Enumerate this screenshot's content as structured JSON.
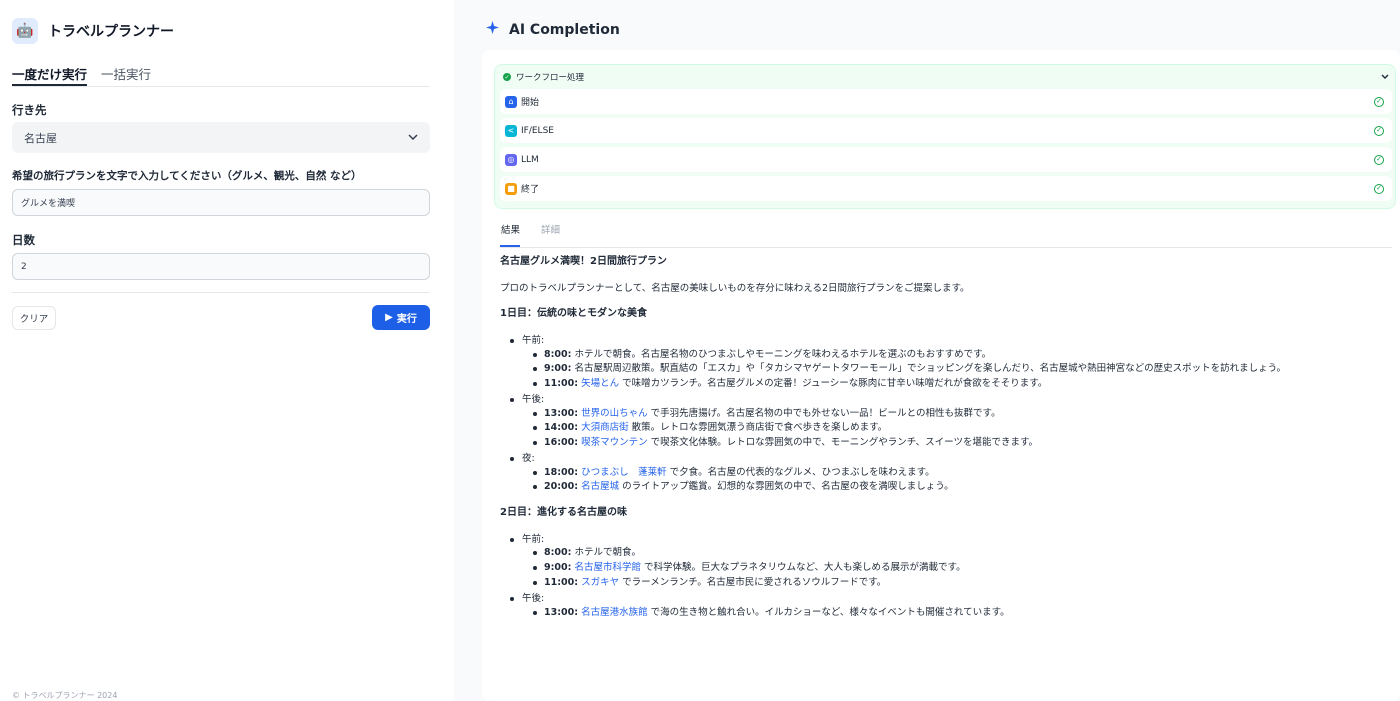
{
  "app": {
    "title": "トラベルプランナー"
  },
  "left": {
    "tabs": [
      {
        "label": "一度だけ実行"
      },
      {
        "label": "一括実行"
      }
    ],
    "destination": {
      "label": "行き先",
      "value": "名古屋"
    },
    "plan": {
      "label": "希望の旅行プランを文字で入力してください（グルメ、観光、自然 など）",
      "value": "グルメを満喫"
    },
    "days": {
      "label": "日数",
      "value": "2"
    },
    "clear_label": "クリア",
    "run_label": "実行",
    "footer": "© トラベルプランナー 2024"
  },
  "right": {
    "title": "AI Completion",
    "workflow": {
      "header": "ワークフロー処理",
      "nodes": [
        {
          "label": "開始",
          "color": "#2563eb"
        },
        {
          "label": "IF/ELSE",
          "color": "#06b6d4"
        },
        {
          "label": "LLM",
          "color": "#6366f1"
        },
        {
          "label": "終了",
          "color": "#f59e0b"
        }
      ]
    },
    "tabs": [
      {
        "label": "結果"
      },
      {
        "label": "詳細"
      }
    ],
    "result": {
      "title": "名古屋グルメ満喫！2日間旅行プラン",
      "intro": "プロのトラベルプランナーとして、名古屋の美味しいものを存分に味わえる2日間旅行プランをご提案します。",
      "day1": {
        "heading": "1日目：伝統の味とモダンな美食",
        "morning": {
          "label": "午前:",
          "items": [
            {
              "time": "8:00:",
              "link": "",
              "text": " ホテルで朝食。名古屋名物のひつまぶしやモーニングを味わえるホテルを選ぶのもおすすめです。"
            },
            {
              "time": "9:00:",
              "link": "",
              "text": " 名古屋駅周辺散策。駅直結の「エスカ」や「タカシマヤゲートタワーモール」でショッピングを楽しんだり、名古屋城や熱田神宮などの歴史スポットを訪れましょう。"
            },
            {
              "time": "11:00:",
              "link": "矢場とん",
              "text": " で味噌カツランチ。名古屋グルメの定番！ジューシーな豚肉に甘辛い味噌だれが食欲をそそります。"
            }
          ]
        },
        "afternoon": {
          "label": "午後:",
          "items": [
            {
              "time": "13:00:",
              "link": "世界の山ちゃん",
              "text": " で手羽先唐揚げ。名古屋名物の中でも外せない一品！ビールとの相性も抜群です。"
            },
            {
              "time": "14:00:",
              "link": "大須商店街",
              "text": " 散策。レトロな雰囲気漂う商店街で食べ歩きを楽しめます。"
            },
            {
              "time": "16:00:",
              "link": "喫茶マウンテン",
              "text": " で喫茶文化体験。レトロな雰囲気の中で、モーニングやランチ、スイーツを堪能できます。"
            }
          ]
        },
        "night": {
          "label": "夜:",
          "items": [
            {
              "time": "18:00:",
              "link": "ひつまぶし　蓬莱軒",
              "text": " で夕食。名古屋の代表的なグルメ、ひつまぶしを味わえます。"
            },
            {
              "time": "20:00:",
              "link": "名古屋城",
              "text": " のライトアップ鑑賞。幻想的な雰囲気の中で、名古屋の夜を満喫しましょう。"
            }
          ]
        }
      },
      "day2": {
        "heading": "2日目：進化する名古屋の味",
        "morning": {
          "label": "午前:",
          "items": [
            {
              "time": "8:00:",
              "link": "",
              "text": " ホテルで朝食。"
            },
            {
              "time": "9:00:",
              "link": "名古屋市科学館",
              "text": " で科学体験。巨大なプラネタリウムなど、大人も楽しめる展示が満載です。"
            },
            {
              "time": "11:00:",
              "link": "スガキヤ",
              "text": " でラーメンランチ。名古屋市民に愛されるソウルフードです。"
            }
          ]
        },
        "afternoon": {
          "label": "午後:",
          "items": [
            {
              "time": "13:00:",
              "link": "名古屋港水族館",
              "text": " で海の生き物と触れ合い。イルカショーなど、様々なイベントも開催されています。"
            }
          ]
        }
      }
    }
  }
}
